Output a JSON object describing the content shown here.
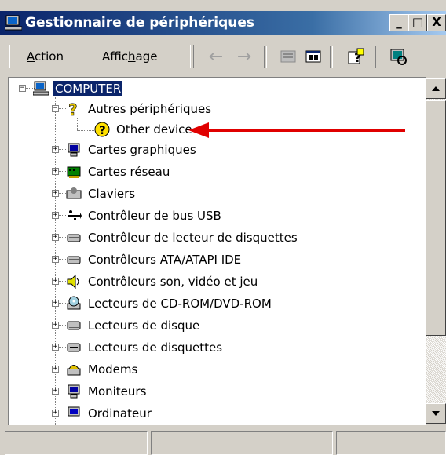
{
  "window": {
    "title": "Gestionnaire de périphériques",
    "controls": {
      "minimize": "_",
      "maximize": "□",
      "close": "X"
    }
  },
  "menu": {
    "action": {
      "label_pre": "",
      "label_u": "A",
      "label_post": "ction"
    },
    "view": {
      "label_pre": "Affic",
      "label_u": "h",
      "label_post": "age"
    }
  },
  "toolbar": {
    "back_glyph": "←",
    "forward_glyph": "→",
    "buttons": [
      "properties-icon",
      "view-icon",
      "help-icon",
      "scan-hardware-icon"
    ]
  },
  "tree": {
    "root": "COMPUTER",
    "expanded": "Autres périphériques",
    "child": "Other device",
    "categories": [
      "Cartes graphiques",
      "Cartes réseau",
      "Claviers",
      "Contrôleur de bus USB",
      "Contrôleur de lecteur de disquettes",
      "Contrôleurs ATA/ATAPI IDE",
      "Contrôleurs son, vidéo et jeu",
      "Lecteurs de CD-ROM/DVD-ROM",
      "Lecteurs de disque",
      "Lecteurs de disquettes",
      "Modems",
      "Moniteurs",
      "Ordinateur"
    ]
  },
  "annotation": {
    "arrow_color": "#e00000",
    "points_to": "Other device"
  },
  "colors": {
    "titlebar": "#0a246a",
    "selection": "#0a246a",
    "face": "#d4d0c8"
  }
}
